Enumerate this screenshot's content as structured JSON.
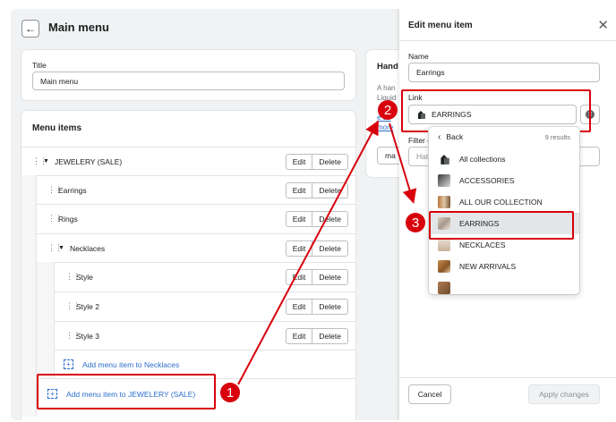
{
  "page": {
    "title": "Main menu",
    "back_icon": "arrow-left-icon"
  },
  "title_card": {
    "label": "Title",
    "value": "Main menu"
  },
  "menu_items_card": {
    "heading": "Menu items",
    "edit_label": "Edit",
    "delete_label": "Delete",
    "items": [
      {
        "label": "JEWELERY (SALE)",
        "level": 0,
        "expanded": true
      },
      {
        "label": "Earrings",
        "level": 1,
        "expanded": false
      },
      {
        "label": "Rings",
        "level": 1,
        "expanded": false
      },
      {
        "label": "Necklaces",
        "level": 1,
        "expanded": true
      },
      {
        "label": "Style",
        "level": 2,
        "expanded": false
      },
      {
        "label": "Style 2",
        "level": 2,
        "expanded": false
      },
      {
        "label": "Style 3",
        "level": 2,
        "expanded": false
      }
    ],
    "add_to_necklaces": "Add menu item to Necklaces",
    "add_to_jewelery": "Add menu item to JEWELERY (SALE)"
  },
  "side_card": {
    "heading_partial": "Hand",
    "text_line1": "A han",
    "text_line2": "Liquid",
    "link_line1": "e de",
    "link_line2": "more",
    "input_partial": "ma"
  },
  "edit_panel": {
    "title": "Edit menu item",
    "name_label": "Name",
    "name_value": "Earrings",
    "link_label": "Link",
    "link_value": "EARRINGS",
    "filter_label_partial": "Filter c",
    "filter_placeholder_partial": "Hats",
    "cancel_label": "Cancel",
    "apply_label": "Apply changes"
  },
  "dropdown": {
    "back_label": "Back",
    "results_count": "9 results",
    "options": [
      {
        "label": "All collections",
        "icon": "collection-icon",
        "selected": false
      },
      {
        "label": "ACCESSORIES",
        "icon": "image-thumbnail",
        "selected": false
      },
      {
        "label": "ALL OUR COLLECTION",
        "icon": "image-thumbnail",
        "selected": false
      },
      {
        "label": "EARRINGS",
        "icon": "image-thumbnail",
        "selected": true
      },
      {
        "label": "NECKLACES",
        "icon": "image-thumbnail",
        "selected": false
      },
      {
        "label": "NEW ARRIVALS",
        "icon": "image-thumbnail",
        "selected": false
      }
    ]
  },
  "annotations": {
    "step1": "1",
    "step2": "2",
    "step3": "3",
    "highlight_color": "#d8000c"
  },
  "colors": {
    "accent_link": "#2c6ecb",
    "background": "#f1f2f3",
    "selected_row": "#e4e5e7"
  }
}
